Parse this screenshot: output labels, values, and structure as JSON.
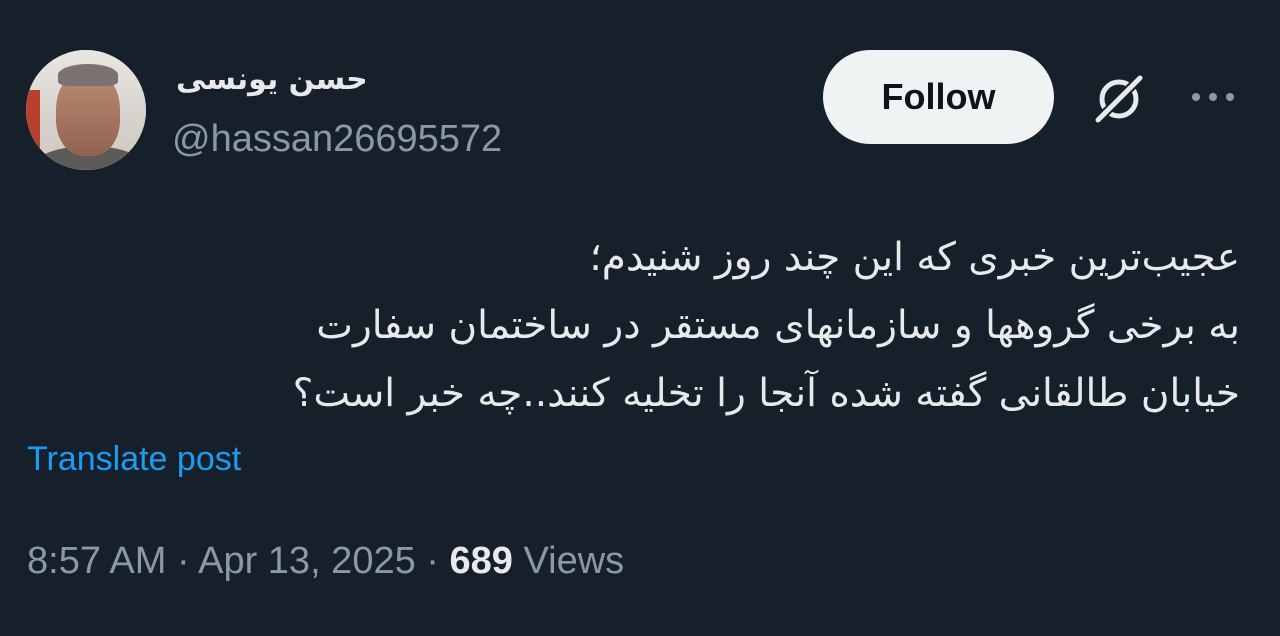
{
  "author": {
    "display_name": "حسن یونسی",
    "handle": "@hassan26695572"
  },
  "actions": {
    "follow_label": "Follow",
    "grok_icon": "grok-icon",
    "more_icon": "more-icon"
  },
  "post": {
    "lines": [
      "عجیب‌ترین خبری که این چند روز شنیدم؛",
      "به برخی گروهها و سازمانهای مستقر در ساختمان سفارت",
      "خیابان طالقانی گفته شده آنجا را تخلیه کنند..چه خبر است؟"
    ],
    "translate_label": "Translate post"
  },
  "meta": {
    "time": "8:57 AM",
    "separator": "·",
    "date": "Apr 13, 2025",
    "views_count": "689",
    "views_label": "Views"
  },
  "colors": {
    "background": "#15202b",
    "text": "#e7e9ea",
    "secondary": "#8b98a5",
    "link": "#1d9bf0",
    "button_bg": "#eff3f4"
  }
}
